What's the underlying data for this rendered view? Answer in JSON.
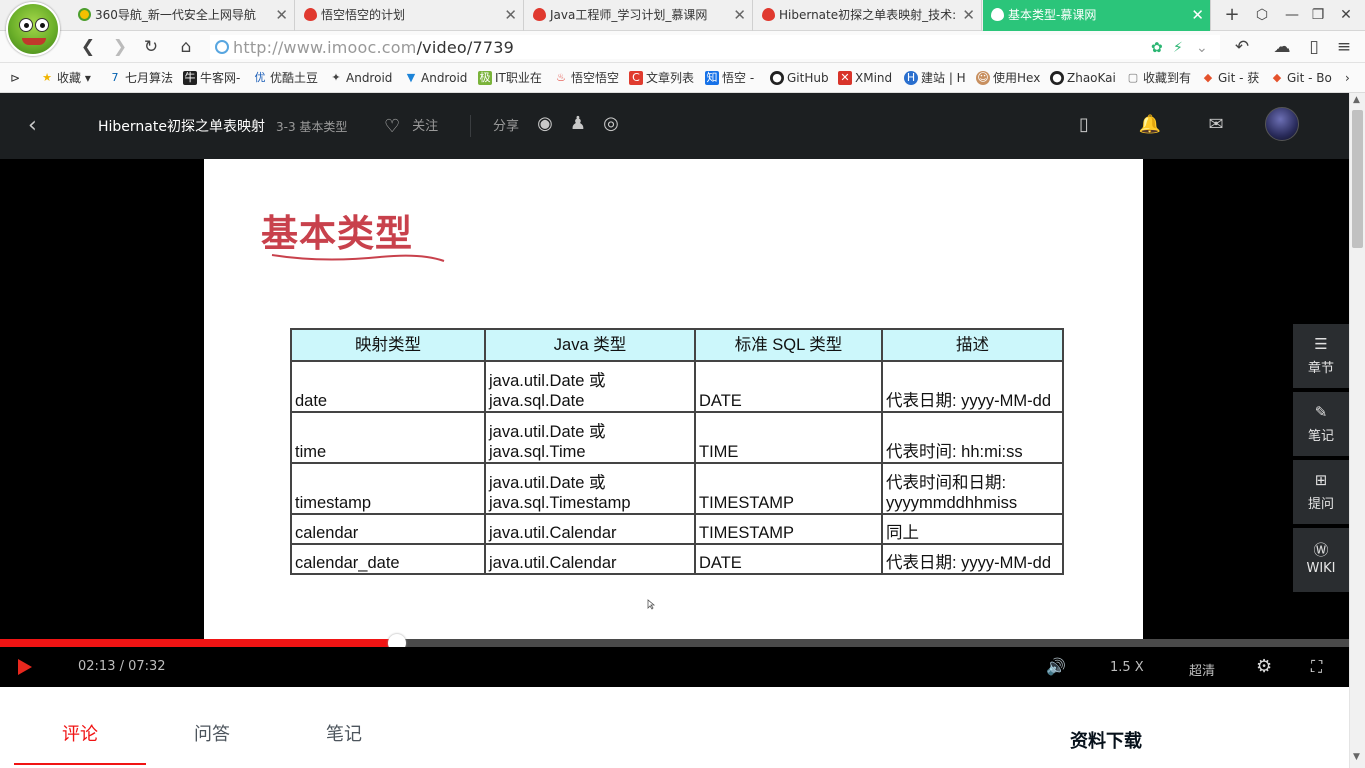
{
  "browser": {
    "tabs": [
      {
        "title": "360导航_新一代安全上网导航",
        "icon": "360-favicon-icon",
        "active": false
      },
      {
        "title": "悟空悟空的计划",
        "icon": "flame-favicon-icon",
        "active": false
      },
      {
        "title": "Java工程师_学习计划_慕课网",
        "icon": "flame-favicon-icon",
        "active": false
      },
      {
        "title": "Hibernate初探之单表映射_技术:",
        "icon": "flame-favicon-icon",
        "active": false
      },
      {
        "title": "基本类型-慕课网",
        "icon": "flame-favicon-icon",
        "active": true
      }
    ],
    "new_tab_label": "+",
    "url_host": "http://www.imooc.com",
    "url_path": "/video/7739",
    "active_tab_color": "#2bc57a"
  },
  "bookmarks": [
    {
      "label": "收藏",
      "icon": "star-icon"
    },
    {
      "label": "七月算法",
      "icon": "seven-icon"
    },
    {
      "label": "牛客网-",
      "icon": "nowcoder-icon"
    },
    {
      "label": "优酷土豆",
      "icon": "youku-icon"
    },
    {
      "label": "Android",
      "icon": "android-icon"
    },
    {
      "label": "Android",
      "icon": "filter-icon"
    },
    {
      "label": "IT职业在",
      "icon": "it-icon"
    },
    {
      "label": "悟空悟空",
      "icon": "flame-icon"
    },
    {
      "label": "文章列表",
      "icon": "csdn-icon"
    },
    {
      "label": "悟空 -",
      "icon": "zhihu-icon"
    },
    {
      "label": "GitHub",
      "icon": "github-icon"
    },
    {
      "label": "XMind",
      "icon": "xmind-icon"
    },
    {
      "label": "建站 | H",
      "icon": "h-icon"
    },
    {
      "label": "使用Hex",
      "icon": "avatar-icon"
    },
    {
      "label": "ZhaoKai",
      "icon": "github-icon"
    },
    {
      "label": "收藏到有",
      "icon": "doc-icon"
    },
    {
      "label": "Git - 获",
      "icon": "git-icon"
    },
    {
      "label": "Git - Bo",
      "icon": "git-icon"
    }
  ],
  "header": {
    "course_title": "Hibernate初探之单表映射",
    "lesson_title": "3-3 基本类型",
    "follow_label": "关注",
    "share_label": "分享"
  },
  "slide": {
    "title": "基本类型",
    "table": {
      "headers": [
        "映射类型",
        "Java 类型",
        "标准 SQL 类型",
        "描述"
      ],
      "rows": [
        {
          "mapping": "date",
          "java1": "java.util.Date 或",
          "java2": "java.sql.Date",
          "sql": "DATE",
          "desc1": "",
          "desc2": "代表日期: yyyy-MM-dd",
          "size": "tall"
        },
        {
          "mapping": "time",
          "java1": "java.util.Date 或",
          "java2": "java.sql.Time",
          "sql": "TIME",
          "desc1": "",
          "desc2": "代表时间: hh:mi:ss",
          "size": "tall"
        },
        {
          "mapping": "timestamp",
          "java1": "java.util.Date 或",
          "java2": "java.sql.Timestamp",
          "sql": "TIMESTAMP",
          "desc1": "代表时间和日期:",
          "desc2": "yyyymmddhhmiss",
          "size": "tall"
        },
        {
          "mapping": "calendar",
          "java1": "",
          "java2": "java.util.Calendar",
          "sql": "TIMESTAMP",
          "desc1": "",
          "desc2": "同上",
          "size": "short"
        },
        {
          "mapping": "calendar_date",
          "java1": "",
          "java2": "java.util.Calendar",
          "sql": "DATE",
          "desc1": "",
          "desc2": "代表日期: yyyy-MM-dd",
          "size": "short"
        }
      ]
    },
    "title_color": "#c8414c",
    "header_fill": "#ccf7fb"
  },
  "side_panel": [
    {
      "label": "章节",
      "icon": "menu-icon"
    },
    {
      "label": "笔记",
      "icon": "pencil-icon"
    },
    {
      "label": "提问",
      "icon": "question-plus-icon"
    },
    {
      "label": "WIKI",
      "icon": "wiki-icon"
    }
  ],
  "player": {
    "time": "02:13 / 07:32",
    "progress": 0.294,
    "speed": "1.5 X",
    "quality": "超清",
    "progress_color": "#f01414"
  },
  "below": {
    "tabs": [
      "评论",
      "问答",
      "笔记"
    ],
    "active_tab": "评论",
    "downloads_title": "资料下载"
  }
}
